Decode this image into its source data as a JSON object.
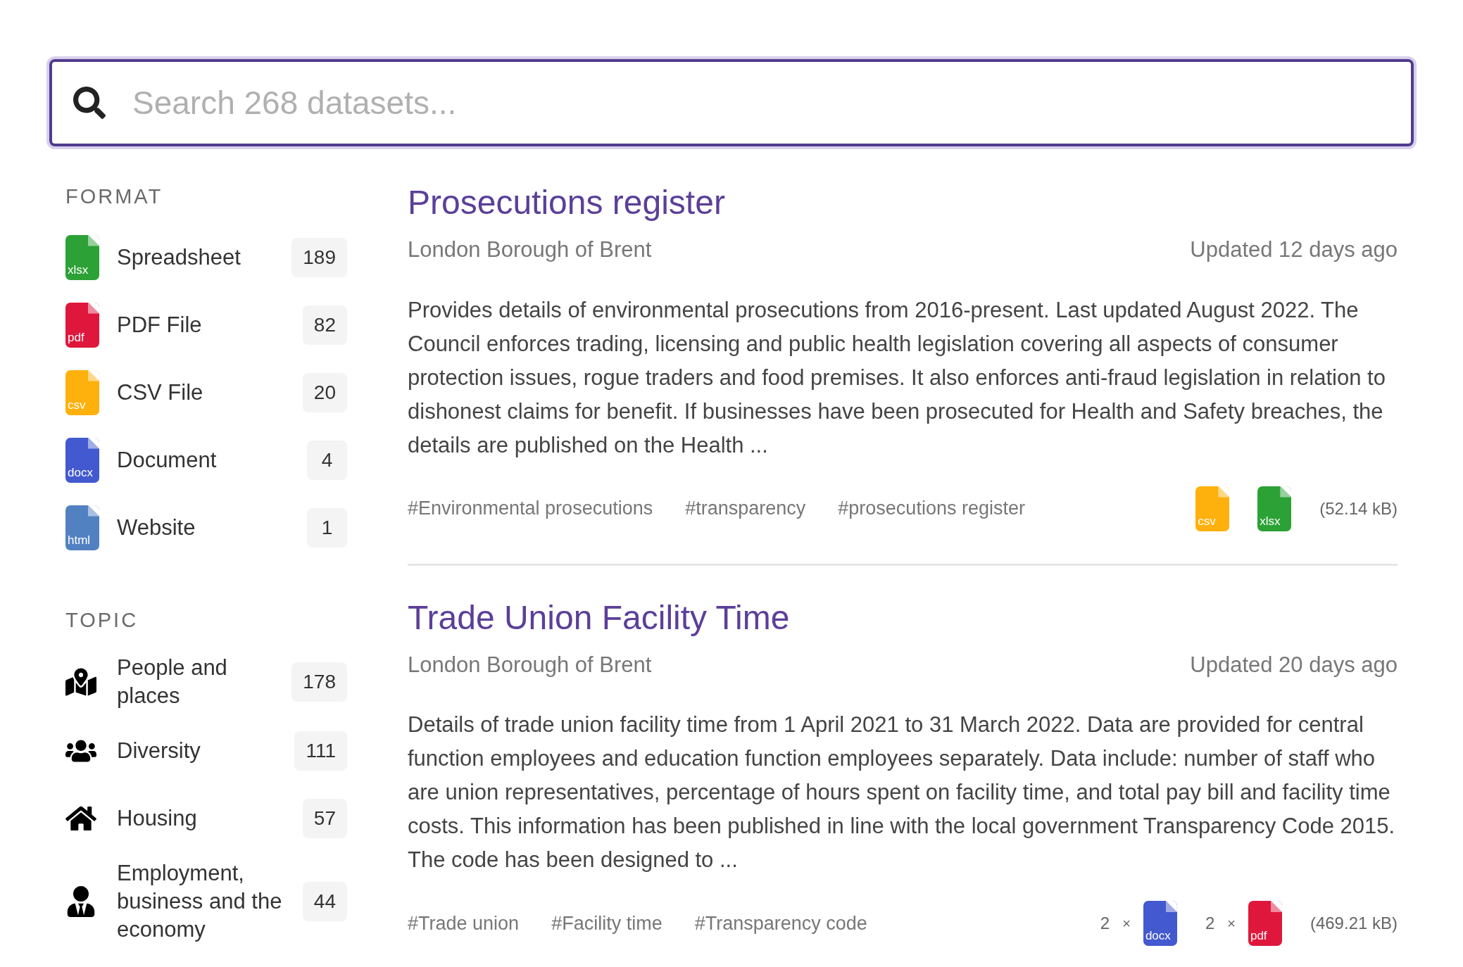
{
  "search": {
    "placeholder": "Search 268 datasets..."
  },
  "sidebar": {
    "sections": [
      {
        "heading": "FORMAT",
        "items": [
          {
            "kind": "file",
            "icon_label": "xlsx",
            "color": "#2ca135",
            "label": "Spreadsheet",
            "count": "189"
          },
          {
            "kind": "file",
            "icon_label": "pdf",
            "color": "#e0173c",
            "label": "PDF File",
            "count": "82"
          },
          {
            "kind": "file",
            "icon_label": "csv",
            "color": "#feb00c",
            "label": "CSV File",
            "count": "20"
          },
          {
            "kind": "file",
            "icon_label": "docx",
            "color": "#4259cf",
            "label": "Document",
            "count": "4"
          },
          {
            "kind": "file",
            "icon_label": "html",
            "color": "#5281c2",
            "label": "Website",
            "count": "1"
          }
        ]
      },
      {
        "heading": "TOPIC",
        "items": [
          {
            "kind": "topic",
            "label": "People and places",
            "count": "178"
          },
          {
            "kind": "topic",
            "label": "Diversity",
            "count": "111"
          },
          {
            "kind": "topic",
            "label": "Housing",
            "count": "57"
          },
          {
            "kind": "topic",
            "label": "Employment, business and the economy",
            "count": "44"
          }
        ]
      }
    ]
  },
  "results": [
    {
      "title": "Prosecutions register",
      "publisher": "London Borough of Brent",
      "updated": "Updated 12 days ago",
      "description": "Provides details of environmental prosecutions from 2016-present. Last updated August 2022. The Council enforces trading, licensing and public health legislation covering all aspects of consumer protection issues, rogue traders and food premises. It also enforces anti-fraud legislation in relation to dishonest claims for benefit. If businesses have been prosecuted for Health and Safety breaches, the details are published on the Health ...",
      "tags": [
        "#Environmental prosecutions",
        "#transparency",
        "#prosecutions register"
      ],
      "files": [
        {
          "label": "csv",
          "color": "#feb00c"
        },
        {
          "label": "xlsx",
          "color": "#2ca135"
        }
      ],
      "size": "(52.14 kB)"
    },
    {
      "title": "Trade Union Facility Time",
      "publisher": "London Borough of Brent",
      "updated": "Updated 20 days ago",
      "description": "Details of trade union facility time from 1 April 2021 to 31 March 2022. Data are provided for central function employees and education function employees separately. Data include: number of staff who are union representatives, percentage of hours spent on facility time, and total pay bill and facility time costs. This information has been published in line with the local government Transparency Code 2015. The code has been designed to ...",
      "tags": [
        "#Trade union",
        "#Facility time",
        "#Transparency code"
      ],
      "files": [
        {
          "count": "2",
          "times": "×",
          "label": "docx",
          "color": "#4259cf"
        },
        {
          "count": "2",
          "times": "×",
          "label": "pdf",
          "color": "#e0173c"
        }
      ],
      "size": "(469.21 kB)"
    }
  ]
}
